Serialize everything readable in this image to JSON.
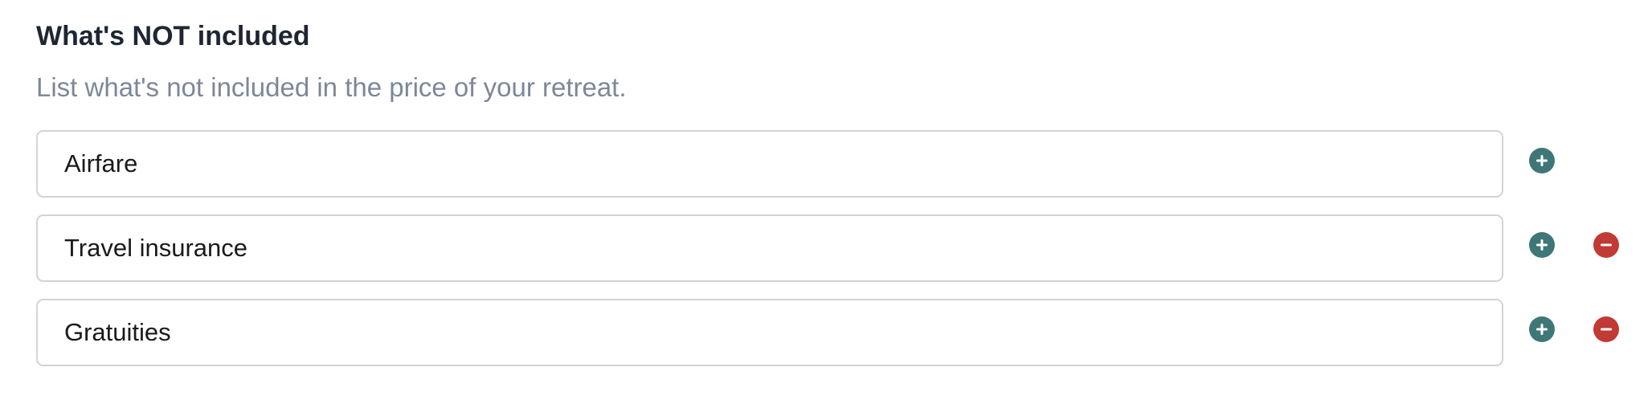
{
  "section": {
    "title": "What's NOT included",
    "subtitle": "List what's not included in the price of your retreat."
  },
  "items": [
    {
      "value": "Airfare",
      "actions": [
        "add-icon"
      ]
    },
    {
      "value": "Travel insurance",
      "actions": [
        "add-icon",
        "remove-icon"
      ]
    },
    {
      "value": "Gratuities",
      "actions": [
        "add-icon",
        "remove-icon"
      ]
    }
  ],
  "colors": {
    "add_button": "#3f7778",
    "remove_button": "#c13a33",
    "title_text": "#1f2633",
    "subtitle_text": "#7d8799",
    "input_border": "#d3d3d3"
  }
}
